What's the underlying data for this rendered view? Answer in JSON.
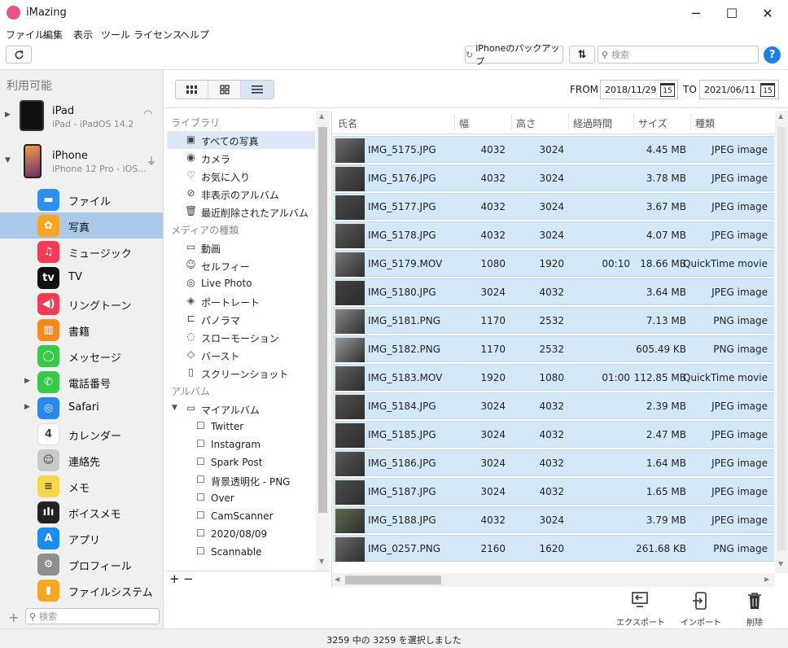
{
  "window": {
    "title": "iMazing",
    "minimize": "─",
    "maximize": "☐",
    "close": "✕"
  },
  "menu": [
    "ファイル",
    "編集",
    "表示",
    "ツール",
    "ライセンス",
    "ヘルプ"
  ],
  "toolbar": {
    "refresh_icon": "refresh-icon",
    "backup_label": "iPhoneのバックアップ",
    "transfer_icon": "⇅",
    "search_placeholder": "検索",
    "help_label": "?"
  },
  "sidebar": {
    "heading": "利用可能",
    "devices": [
      {
        "name": "iPad",
        "subtitle": "iPad - iPadOS 14.2",
        "status_icon": "wifi-icon"
      },
      {
        "name": "iPhone",
        "subtitle": "iPhone 12 Pro - iOS...",
        "status_icon": "usb-icon"
      }
    ],
    "apps": [
      {
        "label": "ファイル",
        "icon": "folder-icon",
        "color": "#2f8ff0",
        "glyph": "▬",
        "expandable": false,
        "selected": false
      },
      {
        "label": "写真",
        "icon": "photos-icon",
        "color": "#f6a623",
        "glyph": "✿",
        "expandable": false,
        "selected": true
      },
      {
        "label": "ミュージック",
        "icon": "music-icon",
        "color": "#f23b54",
        "glyph": "♫",
        "expandable": false,
        "selected": false
      },
      {
        "label": "TV",
        "icon": "tv-icon",
        "color": "#111111",
        "glyph": "tv",
        "expandable": false,
        "selected": false
      },
      {
        "label": "リングトーン",
        "icon": "ringtone-icon",
        "color": "#f23b54",
        "glyph": "◀)",
        "expandable": false,
        "selected": false
      },
      {
        "label": "書籍",
        "icon": "books-icon",
        "color": "#f28a1c",
        "glyph": "▥",
        "expandable": false,
        "selected": false
      },
      {
        "label": "メッセージ",
        "icon": "messages-icon",
        "color": "#39c949",
        "glyph": "◯",
        "expandable": false,
        "selected": false
      },
      {
        "label": "電話番号",
        "icon": "phone-icon",
        "color": "#39c949",
        "glyph": "✆",
        "expandable": true,
        "selected": false
      },
      {
        "label": "Safari",
        "icon": "safari-icon",
        "color": "#2a86f0",
        "glyph": "◎",
        "expandable": true,
        "selected": false
      },
      {
        "label": "カレンダー",
        "icon": "calendar-icon",
        "color": "#ffffff",
        "glyph": "4",
        "expandable": false,
        "selected": false
      },
      {
        "label": "連絡先",
        "icon": "contacts-icon",
        "color": "#c9c9c9",
        "glyph": "☺",
        "expandable": false,
        "selected": false
      },
      {
        "label": "メモ",
        "icon": "notes-icon",
        "color": "#f7d64a",
        "glyph": "≡",
        "expandable": false,
        "selected": false
      },
      {
        "label": "ボイスメモ",
        "icon": "voice-memo-icon",
        "color": "#222222",
        "glyph": "ıIı",
        "expandable": false,
        "selected": false
      },
      {
        "label": "アプリ",
        "icon": "appstore-icon",
        "color": "#1c8cf0",
        "glyph": "A",
        "expandable": false,
        "selected": false
      },
      {
        "label": "プロフィール",
        "icon": "profile-icon",
        "color": "#8e8e93",
        "glyph": "⚙",
        "expandable": false,
        "selected": false
      },
      {
        "label": "ファイルシステム",
        "icon": "filesystem-icon",
        "color": "#f5a623",
        "glyph": "▮",
        "expandable": false,
        "selected": false
      }
    ],
    "add_label": "+",
    "search_placeholder": "検索"
  },
  "viewtoggles": [
    "grid-small-icon",
    "grid-large-icon",
    "list-icon"
  ],
  "daterange": {
    "from_label": "FROM",
    "from_value": "2018/11/29",
    "to_label": "TO",
    "to_value": "2021/06/11",
    "calendar_day": "15"
  },
  "library": {
    "sections": [
      {
        "title": "ライブラリ",
        "items": [
          {
            "label": "すべての写真",
            "icon": "photo-icon",
            "glyph": "▣",
            "selected": true
          },
          {
            "label": "カメラ",
            "icon": "camera-icon",
            "glyph": "◉",
            "selected": false
          },
          {
            "label": "お気に入り",
            "icon": "heart-icon",
            "glyph": "♡",
            "selected": false
          },
          {
            "label": "非表示のアルバム",
            "icon": "hidden-icon",
            "glyph": "⊘",
            "selected": false
          },
          {
            "label": "最近削除されたアルバム",
            "icon": "trash-icon",
            "glyph": "🗑",
            "selected": false
          }
        ]
      },
      {
        "title": "メディアの種類",
        "items": [
          {
            "label": "動画",
            "icon": "video-icon",
            "glyph": "▭",
            "selected": false
          },
          {
            "label": "セルフィー",
            "icon": "selfie-icon",
            "glyph": "☺",
            "selected": false
          },
          {
            "label": "Live Photo",
            "icon": "live-photo-icon",
            "glyph": "◎",
            "selected": false
          },
          {
            "label": "ポートレート",
            "icon": "portrait-icon",
            "glyph": "◈",
            "selected": false
          },
          {
            "label": "パノラマ",
            "icon": "panorama-icon",
            "glyph": "⊏",
            "selected": false
          },
          {
            "label": "スローモーション",
            "icon": "slowmo-icon",
            "glyph": "◌",
            "selected": false
          },
          {
            "label": "バースト",
            "icon": "burst-icon",
            "glyph": "◇",
            "selected": false
          },
          {
            "label": "スクリーンショット",
            "icon": "screenshot-icon",
            "glyph": "▯",
            "selected": false
          }
        ]
      }
    ],
    "albums_title": "アルバム",
    "my_albums": "マイアルバム",
    "albums": [
      "Twitter",
      "Instagram",
      "Spark Post",
      "背景透明化 - PNG",
      "Over",
      "CamScanner",
      "2020/08/09",
      "Scannable"
    ],
    "add": "+",
    "remove": "−"
  },
  "table": {
    "columns": [
      "氏名",
      "幅",
      "高さ",
      "経過時間",
      "サイズ",
      "種類"
    ],
    "rows": [
      {
        "name": "IMG_5175.JPG",
        "width": "4032",
        "height": "3024",
        "duration": "",
        "size": "4.45 MB",
        "kind": "JPEG image"
      },
      {
        "name": "IMG_5176.JPG",
        "width": "4032",
        "height": "3024",
        "duration": "",
        "size": "3.78 MB",
        "kind": "JPEG image"
      },
      {
        "name": "IMG_5177.JPG",
        "width": "4032",
        "height": "3024",
        "duration": "",
        "size": "3.67 MB",
        "kind": "JPEG image"
      },
      {
        "name": "IMG_5178.JPG",
        "width": "4032",
        "height": "3024",
        "duration": "",
        "size": "4.07 MB",
        "kind": "JPEG image"
      },
      {
        "name": "IMG_5179.MOV",
        "width": "1080",
        "height": "1920",
        "duration": "00:10",
        "size": "18.66 MB",
        "kind": "QuickTime movie"
      },
      {
        "name": "IMG_5180.JPG",
        "width": "3024",
        "height": "4032",
        "duration": "",
        "size": "3.64 MB",
        "kind": "JPEG image"
      },
      {
        "name": "IMG_5181.PNG",
        "width": "1170",
        "height": "2532",
        "duration": "",
        "size": "7.13 MB",
        "kind": "PNG image"
      },
      {
        "name": "IMG_5182.PNG",
        "width": "1170",
        "height": "2532",
        "duration": "",
        "size": "605.49 KB",
        "kind": "PNG image"
      },
      {
        "name": "IMG_5183.MOV",
        "width": "1920",
        "height": "1080",
        "duration": "01:00",
        "size": "112.85 MB",
        "kind": "QuickTime movie"
      },
      {
        "name": "IMG_5184.JPG",
        "width": "3024",
        "height": "4032",
        "duration": "",
        "size": "2.39 MB",
        "kind": "JPEG image"
      },
      {
        "name": "IMG_5185.JPG",
        "width": "3024",
        "height": "4032",
        "duration": "",
        "size": "2.47 MB",
        "kind": "JPEG image"
      },
      {
        "name": "IMG_5186.JPG",
        "width": "3024",
        "height": "4032",
        "duration": "",
        "size": "1.64 MB",
        "kind": "JPEG image"
      },
      {
        "name": "IMG_5187.JPG",
        "width": "3024",
        "height": "4032",
        "duration": "",
        "size": "1.65 MB",
        "kind": "JPEG image"
      },
      {
        "name": "IMG_5188.JPG",
        "width": "4032",
        "height": "3024",
        "duration": "",
        "size": "3.79 MB",
        "kind": "JPEG image"
      },
      {
        "name": "IMG_0257.PNG",
        "width": "2160",
        "height": "1620",
        "duration": "",
        "size": "261.68 KB",
        "kind": "PNG image"
      }
    ]
  },
  "actions": [
    {
      "label": "エクスポート",
      "icon": "export-icon",
      "glyph": "⇱"
    },
    {
      "label": "インポート",
      "icon": "import-icon",
      "glyph": "⇲"
    },
    {
      "label": "削除",
      "icon": "trash-icon",
      "glyph": "🗑"
    }
  ],
  "status": "3259 中の 3259 を選択しました"
}
